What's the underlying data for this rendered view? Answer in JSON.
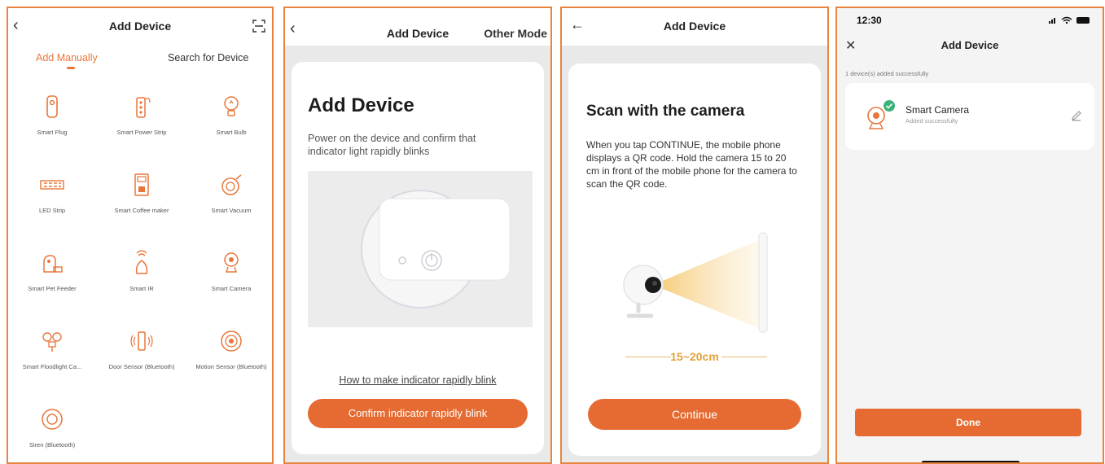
{
  "screen1": {
    "title": "Add Device",
    "tabs": {
      "manual": "Add Manually",
      "search": "Search for Device"
    },
    "devices": [
      {
        "label": "Smart Plug",
        "icon": "smart-plug-icon"
      },
      {
        "label": "Smart Power Strip",
        "icon": "power-strip-icon"
      },
      {
        "label": "Smart Bulb",
        "icon": "bulb-icon"
      },
      {
        "label": "LED Strip",
        "icon": "led-strip-icon"
      },
      {
        "label": "Smart Coffee maker",
        "icon": "coffee-maker-icon"
      },
      {
        "label": "Smart Vacuum",
        "icon": "vacuum-icon"
      },
      {
        "label": "Smart Pet Feeder",
        "icon": "pet-feeder-icon"
      },
      {
        "label": "Smart IR",
        "icon": "ir-icon"
      },
      {
        "label": "Smart Camera",
        "icon": "camera-icon"
      },
      {
        "label": "Smart Floodlight Ca...",
        "icon": "floodlight-icon"
      },
      {
        "label": "Door Sensor (Bluetooth)",
        "icon": "door-sensor-icon"
      },
      {
        "label": "Motion Sensor (Bluetooth)",
        "icon": "motion-sensor-icon"
      },
      {
        "label": "Siren (Bluetooth)",
        "icon": "siren-icon"
      }
    ]
  },
  "screen2": {
    "title": "Add Device",
    "other_mode": "Other Mode",
    "heading": "Add Device",
    "description": "Power on the device and confirm that indicator light rapidly blinks",
    "help_link": "How to make indicator rapidly blink",
    "confirm_button": "Confirm indicator rapidly blink"
  },
  "screen3": {
    "title": "Add Device",
    "heading": "Scan with the camera",
    "description": "When you tap CONTINUE, the mobile phone displays a QR code. Hold the camera 15 to 20 cm in front of the mobile phone for the camera to scan the QR code.",
    "distance": "15~20cm",
    "continue_button": "Continue"
  },
  "screen4": {
    "time": "12:30",
    "title": "Add Device",
    "added_count": "1 device(s) added successfully",
    "device_name": "Smart Camera",
    "device_status": "Added successfully",
    "done_button": "Done"
  },
  "colors": {
    "accent": "#e56b32",
    "frame": "#e8843e",
    "success": "#3bb27a"
  }
}
